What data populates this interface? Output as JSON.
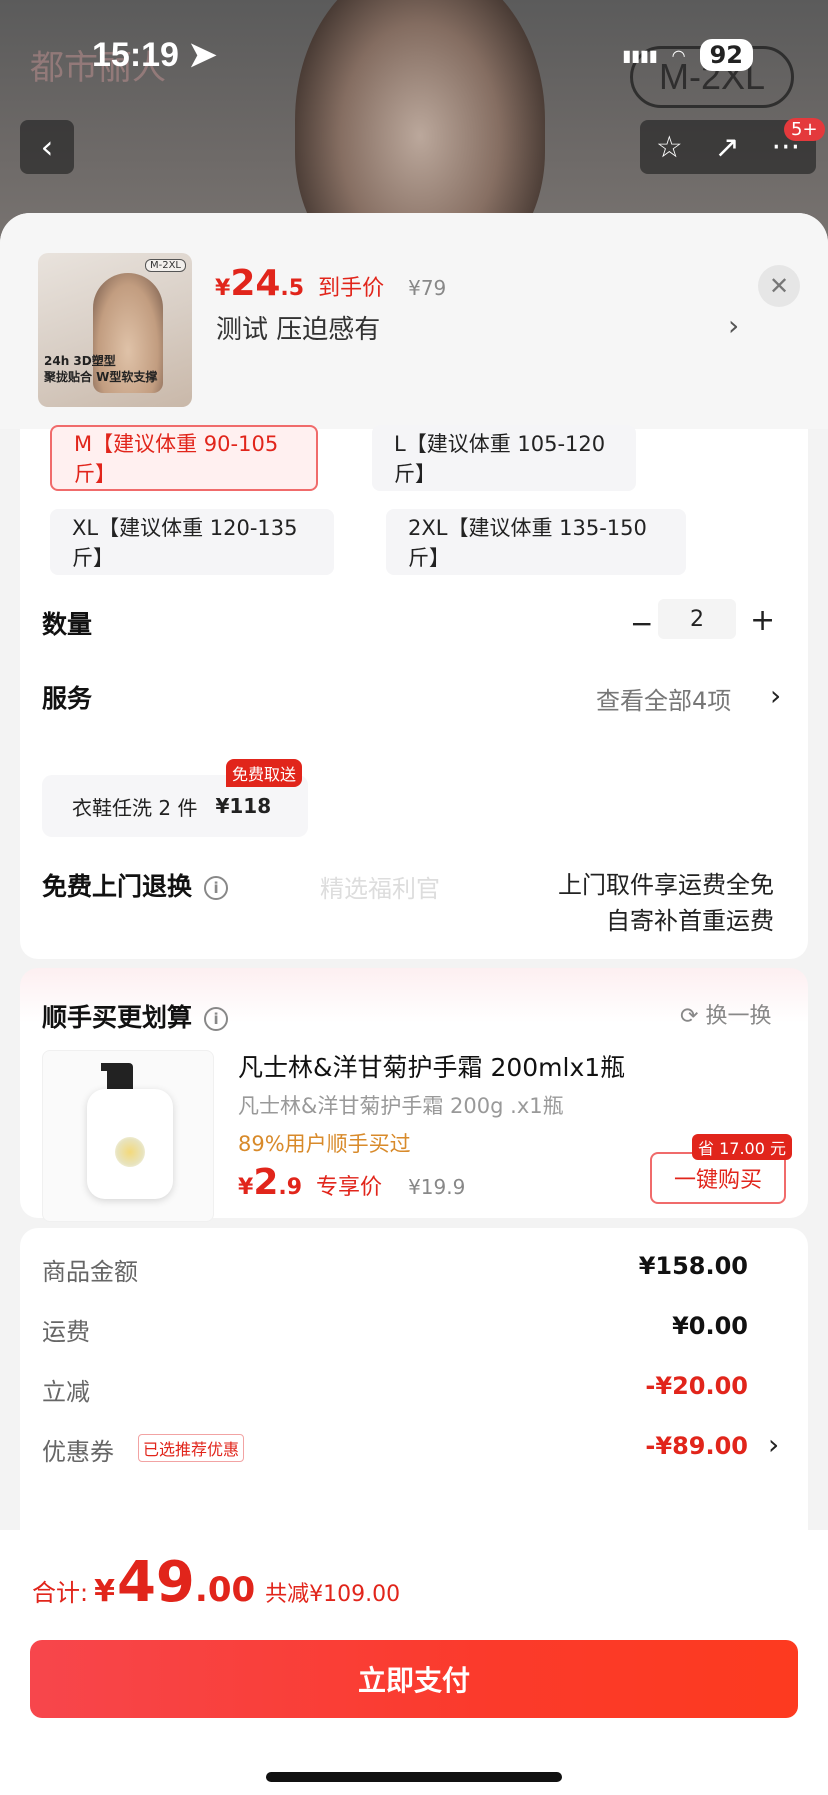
{
  "status_bar": {
    "time": "15:19",
    "battery": "92"
  },
  "background": {
    "brand_text": "都市丽人",
    "size_badge": "M-2XL",
    "message_badge": "5+"
  },
  "header": {
    "price_symbol": "¥",
    "price_int": "24",
    "price_dec": ".5",
    "price_tag": "到手价",
    "original_price": "¥79",
    "selected_spec": "测试  压迫感有",
    "thumb_badge": "M-2XL",
    "thumb_text": "聚拢贴合 W型软支撑",
    "thumb_mark": "24h 3D塑型"
  },
  "sizes": [
    {
      "label": "M【建议体重 90-105 斤】",
      "selected": true
    },
    {
      "label": "L【建议体重 105-120 斤】",
      "selected": false
    },
    {
      "label": "XL【建议体重 120-135 斤】",
      "selected": false
    },
    {
      "label": "2XL【建议体重 135-150 斤】",
      "selected": false
    }
  ],
  "quantity": {
    "label": "数量",
    "minus": "−",
    "value": "2",
    "plus": "+"
  },
  "service": {
    "label": "服务",
    "view_all": "查看全部4项",
    "chip_name": "衣鞋任洗 2 件",
    "chip_price": "¥118",
    "chip_badge": "免费取送"
  },
  "returns": {
    "label": "免费上门退换",
    "watermark": "精选福利官",
    "line1": "上门取件享运费全免",
    "line2": "自寄补首重运费"
  },
  "addon": {
    "title": "顺手买更划算",
    "refresh": "换一换",
    "name": "凡士林&洋甘菊护手霜 200mlx1瓶",
    "spec": "凡士林&洋甘菊护手霜 200g .x1瓶",
    "social": "89%用户顺手买过",
    "price_symbol": "¥",
    "price_int": "2",
    "price_dec": ".9",
    "price_tag": "专享价",
    "original_price": "¥19.9",
    "buy_label": "一键购买",
    "save_badge": "省 17.00 元"
  },
  "summary": {
    "rows": [
      {
        "label": "商品金额",
        "value": "¥158.00"
      },
      {
        "label": "运费",
        "value": "¥0.00"
      },
      {
        "label": "立减",
        "value": "-¥20.00"
      },
      {
        "label": "优惠券",
        "value": "-¥89.00"
      }
    ],
    "coupon_tag": "已选推荐优惠"
  },
  "footer": {
    "total_label": "合计:",
    "total_symbol": "¥",
    "total_int": "49",
    "total_dec": ".00",
    "total_saved": "共减¥109.00",
    "pay_label": "立即支付"
  },
  "colors": {
    "accent": "#e1251b",
    "pay_gradient_start": "#f7464c",
    "pay_gradient_end": "#fd3a1f"
  }
}
